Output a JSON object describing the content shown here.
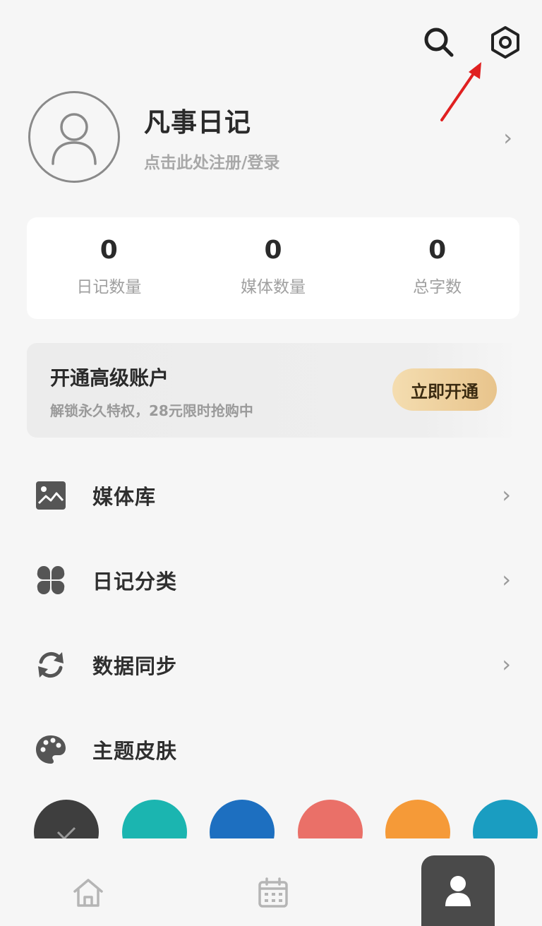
{
  "header": {
    "icons": [
      "search-icon",
      "settings-hexagon-icon"
    ]
  },
  "profile": {
    "title": "凡事日记",
    "subtitle": "点击此处注册/登录",
    "avatar_icon": "user-outline-icon"
  },
  "stats": [
    {
      "value": "0",
      "label": "日记数量"
    },
    {
      "value": "0",
      "label": "媒体数量"
    },
    {
      "value": "0",
      "label": "总字数"
    }
  ],
  "premium": {
    "title": "开通高级账户",
    "subtitle": "解锁永久特权，28元限时抢购中",
    "button": "立即开通"
  },
  "menu": [
    {
      "label": "媒体库",
      "icon": "image-icon",
      "chevron": true
    },
    {
      "label": "日记分类",
      "icon": "grid-icon",
      "chevron": true
    },
    {
      "label": "数据同步",
      "icon": "sync-icon",
      "chevron": true
    },
    {
      "label": "主题皮肤",
      "icon": "palette-icon",
      "chevron": false
    }
  ],
  "theme_swatches": [
    {
      "color": "#3e3e3e",
      "selected": true
    },
    {
      "color": "#1bb5b0",
      "selected": false
    },
    {
      "color": "#1d6fc0",
      "selected": false
    },
    {
      "color": "#ea7068",
      "selected": false
    },
    {
      "color": "#f59a38",
      "selected": false
    },
    {
      "color": "#1a9dc1",
      "selected": false
    }
  ],
  "bottom_nav": {
    "items": [
      "home-icon",
      "calendar-icon",
      "profile-icon"
    ],
    "active": "profile-icon"
  },
  "chevron_glyph": "›"
}
